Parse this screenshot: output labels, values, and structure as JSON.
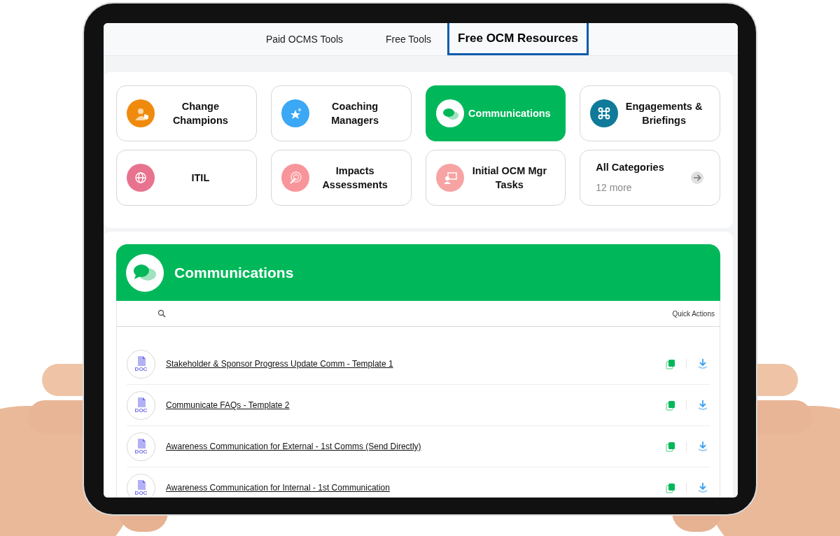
{
  "tabs": [
    {
      "label": "Paid OCMS Tools",
      "selected": false
    },
    {
      "label": "Free Tools",
      "selected": false
    },
    {
      "label": "Free OCM Resources",
      "selected": true
    }
  ],
  "categories": [
    {
      "kind": "category",
      "label": "Change Champions",
      "color": "#f08a0c",
      "selected": false
    },
    {
      "kind": "category",
      "label": "Coaching Managers",
      "color": "#3aa8f5",
      "selected": false
    },
    {
      "kind": "category",
      "label": "Communications",
      "color": "#ffffff",
      "selected": true
    },
    {
      "kind": "category",
      "label": "Engagements & Briefings",
      "color": "#0f7a9a",
      "selected": false
    },
    {
      "kind": "category",
      "label": "ITIL",
      "color": "#e8738f",
      "selected": false
    },
    {
      "kind": "category",
      "label": "Impacts Assessments",
      "color": "#f7959a",
      "selected": false
    },
    {
      "kind": "category",
      "label": "Initial OCM Mgr Tasks",
      "color": "#f7a3a3",
      "selected": false
    },
    {
      "kind": "all",
      "label": "All Categories",
      "count": "12 more",
      "selected": false
    }
  ],
  "panel": {
    "title": "Communications",
    "quick_actions": "Quick Actions"
  },
  "documents": [
    {
      "badge": "DOC",
      "title": "Stakeholder & Sponsor Progress Update Comm - Template 1"
    },
    {
      "badge": "DOC",
      "title": "Communicate FAQs - Template 2"
    },
    {
      "badge": "DOC",
      "title": "Awareness Communication for External - 1st Comms (Send Directly)"
    },
    {
      "badge": "DOC",
      "title": "Awareness Communication for Internal - 1st Communication"
    }
  ]
}
